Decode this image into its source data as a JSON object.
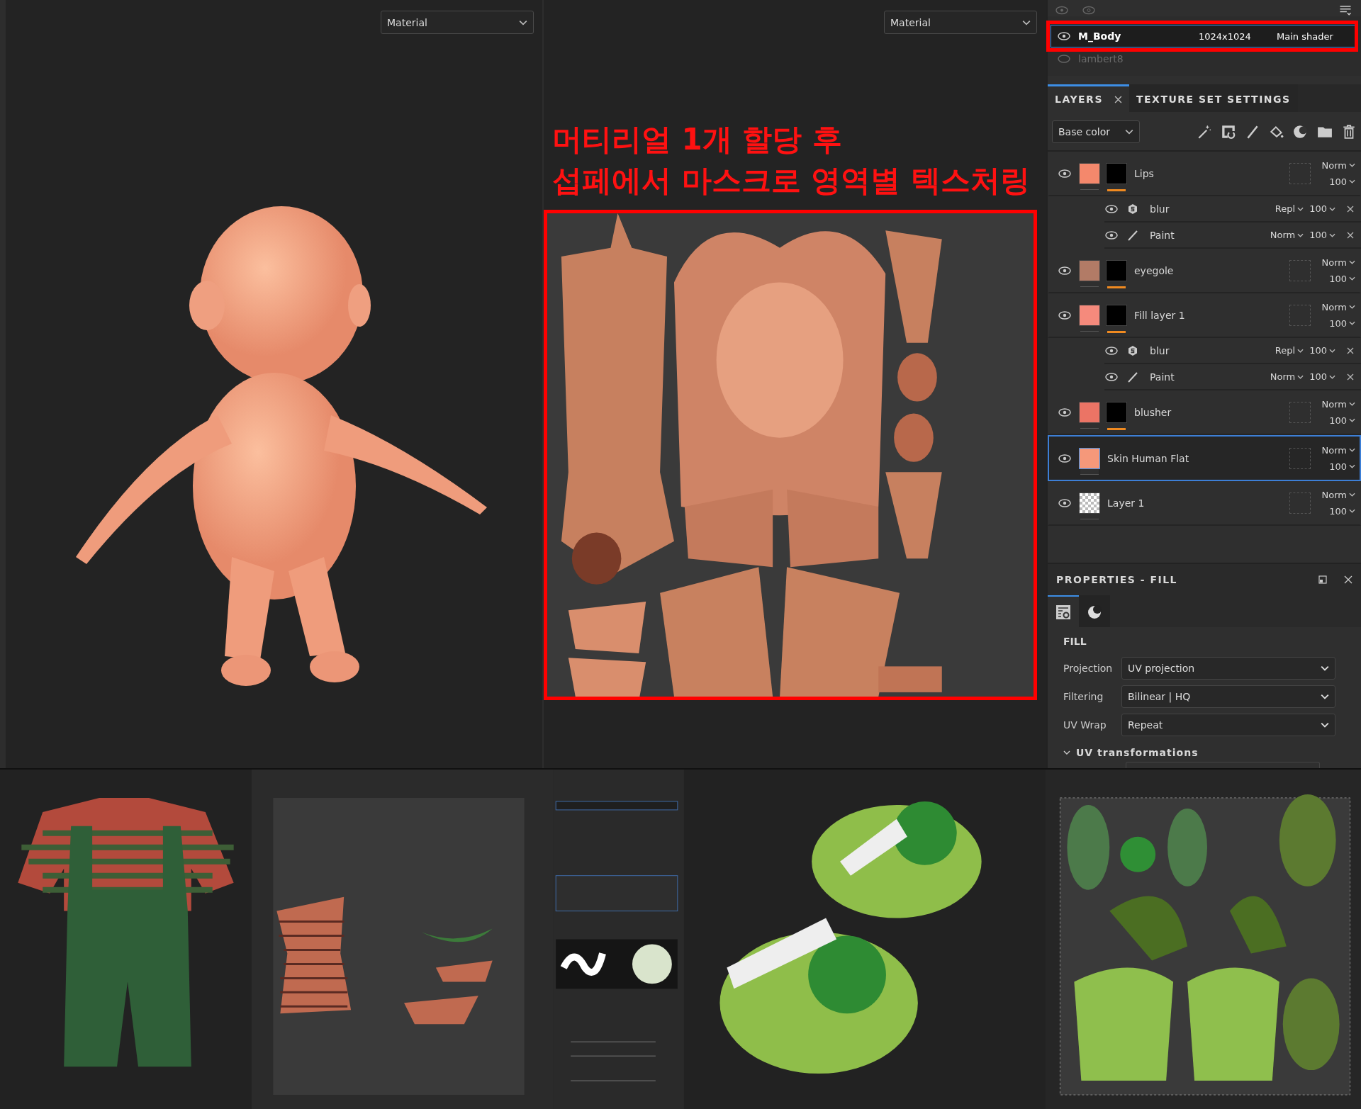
{
  "viewports": [
    {
      "dropdown": "Material"
    },
    {
      "dropdown": "Material"
    }
  ],
  "annotation": {
    "lines": [
      "머티리얼 1개 할당 후",
      "섭페에서 마스크로 영역별 텍스처링"
    ]
  },
  "texture_sets": [
    {
      "name": "M_Body",
      "resolution": "1024x1024",
      "shader": "Main shader",
      "selected": true,
      "enabled": true
    },
    {
      "name": "lambert8",
      "selected": false,
      "enabled": false
    }
  ],
  "tabs": [
    {
      "label": "LAYERS",
      "selected": true
    },
    {
      "label": "TEXTURE SET SETTINGS",
      "selected": false
    }
  ],
  "channel_dropdown": "Base color",
  "layers": [
    {
      "kind": "fill",
      "name": "Lips",
      "color": "#f4886c",
      "mask": true,
      "blend": "Norm",
      "opacity": "100",
      "selected": false,
      "children": [
        {
          "kind": "filter",
          "name": "blur",
          "blend": "Repl",
          "opacity": "100"
        },
        {
          "kind": "paint",
          "name": "Paint",
          "blend": "Norm",
          "opacity": "100"
        }
      ]
    },
    {
      "kind": "fill",
      "name": "eyegole",
      "color": "#b27b66",
      "mask": true,
      "blend": "Norm",
      "opacity": "100",
      "selected": false
    },
    {
      "kind": "fill",
      "name": "Fill layer 1",
      "color": "#f58a7c",
      "mask": true,
      "blend": "Norm",
      "opacity": "100",
      "selected": false,
      "children": [
        {
          "kind": "filter",
          "name": "blur",
          "blend": "Repl",
          "opacity": "100"
        },
        {
          "kind": "paint",
          "name": "Paint",
          "blend": "Norm",
          "opacity": "100"
        }
      ]
    },
    {
      "kind": "fill",
      "name": "blusher",
      "color": "#eb7465",
      "mask": true,
      "blend": "Norm",
      "opacity": "100",
      "selected": false
    },
    {
      "kind": "fill",
      "name": "Skin Human Flat",
      "color": "#f5987a",
      "mask": false,
      "blend": "Norm",
      "opacity": "100",
      "selected": true
    },
    {
      "kind": "paint",
      "name": "Layer 1",
      "mask": false,
      "blend": "Norm",
      "opacity": "100",
      "selected": false
    }
  ],
  "properties": {
    "title": "PROPERTIES - FILL",
    "tabs": [
      {
        "kind": "settings",
        "selected": true
      },
      {
        "kind": "material",
        "selected": false
      }
    ],
    "section": "FILL",
    "fields": [
      {
        "label": "Projection",
        "value": "UV projection"
      },
      {
        "label": "Filtering",
        "value": "Bilinear | HQ"
      },
      {
        "label": "UV Wrap",
        "value": "Repeat"
      }
    ],
    "group": {
      "label": "UV transformations",
      "expanded": true
    }
  }
}
